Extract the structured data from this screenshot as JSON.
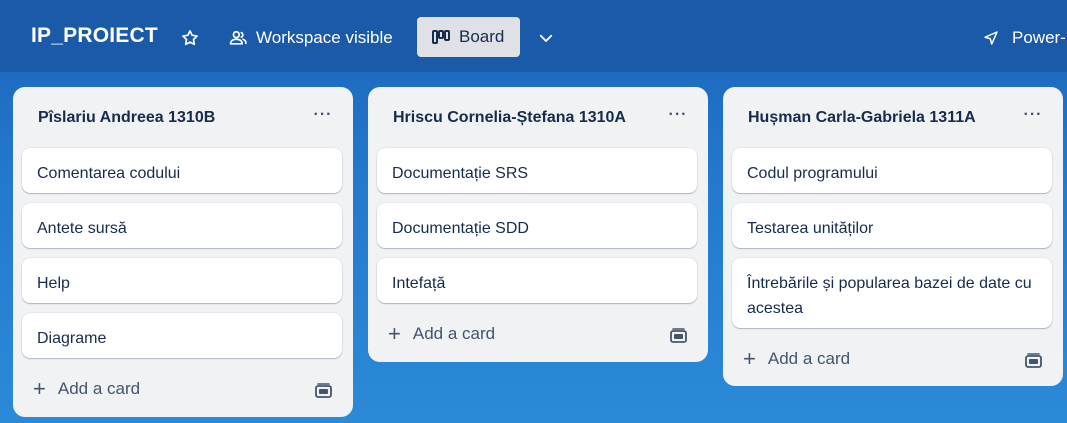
{
  "header": {
    "board_title": "IP_PROIECT",
    "visibility_label": "Workspace visible",
    "view_label": "Board",
    "power_label": "Power-"
  },
  "icons": {
    "star": "star-icon",
    "visibility": "people-icon",
    "board": "board-view-icon",
    "chevron": "chevron-down-icon",
    "power": "rocket-icon",
    "menu": "more-horizontal-icon",
    "add": "plus-icon",
    "template": "card-template-icon"
  },
  "colors": {
    "header_bg": "#1a5aa8",
    "list_bg": "#f1f2f4",
    "card_bg": "#ffffff",
    "text": "#172b4d"
  },
  "lists": [
    {
      "title": "Pîslariu Andreea 1310B",
      "menu": "···",
      "cards": [
        "Comentarea codului",
        "Antete sursă",
        "Help",
        "Diagrame"
      ],
      "add_label": "Add a card"
    },
    {
      "title": "Hriscu Cornelia-Ștefana 1310A",
      "menu": "···",
      "cards": [
        "Documentație SRS",
        "Documentație SDD",
        "Intefață"
      ],
      "add_label": "Add a card"
    },
    {
      "title": "Hușman Carla-Gabriela 1311A",
      "menu": "···",
      "cards": [
        "Codul programului",
        "Testarea unităților",
        "Întrebările și popularea bazei de date cu acestea"
      ],
      "add_label": "Add a card"
    }
  ]
}
